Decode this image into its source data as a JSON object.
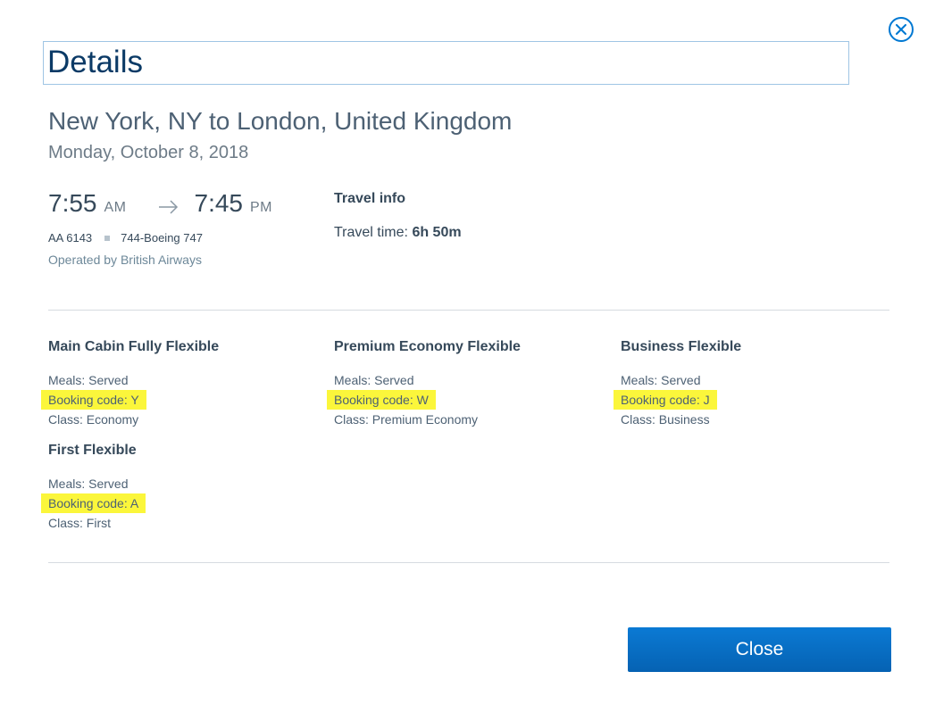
{
  "dialog": {
    "title": "Details",
    "close_icon": "close-circle-icon"
  },
  "trip": {
    "route": "New York, NY to London, United Kingdom",
    "date": "Monday, October 8, 2018"
  },
  "segment": {
    "depart_time": "7:55",
    "depart_ampm": "AM",
    "arrive_time": "7:45",
    "arrive_ampm": "PM",
    "flight_number": "AA 6143",
    "aircraft": "744-Boeing 747",
    "operated_by": "Operated by British Airways"
  },
  "travel_info": {
    "title": "Travel info",
    "time_label": "Travel time:",
    "time_value": "6h 50m"
  },
  "cabins": [
    {
      "name": "Main Cabin Fully Flexible",
      "meals": "Meals: Served",
      "booking_code": "Booking code: Y",
      "class": "Class: Economy"
    },
    {
      "name": "Premium Economy Flexible",
      "meals": "Meals: Served",
      "booking_code": "Booking code: W",
      "class": "Class: Premium Economy"
    },
    {
      "name": "Business Flexible",
      "meals": "Meals: Served",
      "booking_code": "Booking code: J",
      "class": "Class: Business"
    },
    {
      "name": "First Flexible",
      "meals": "Meals: Served",
      "booking_code": "Booking code: A",
      "class": "Class: First"
    }
  ],
  "footer": {
    "close_label": "Close"
  },
  "colors": {
    "primary": "#0078d2",
    "highlight": "#fbf63b",
    "title": "#0b3a66"
  }
}
